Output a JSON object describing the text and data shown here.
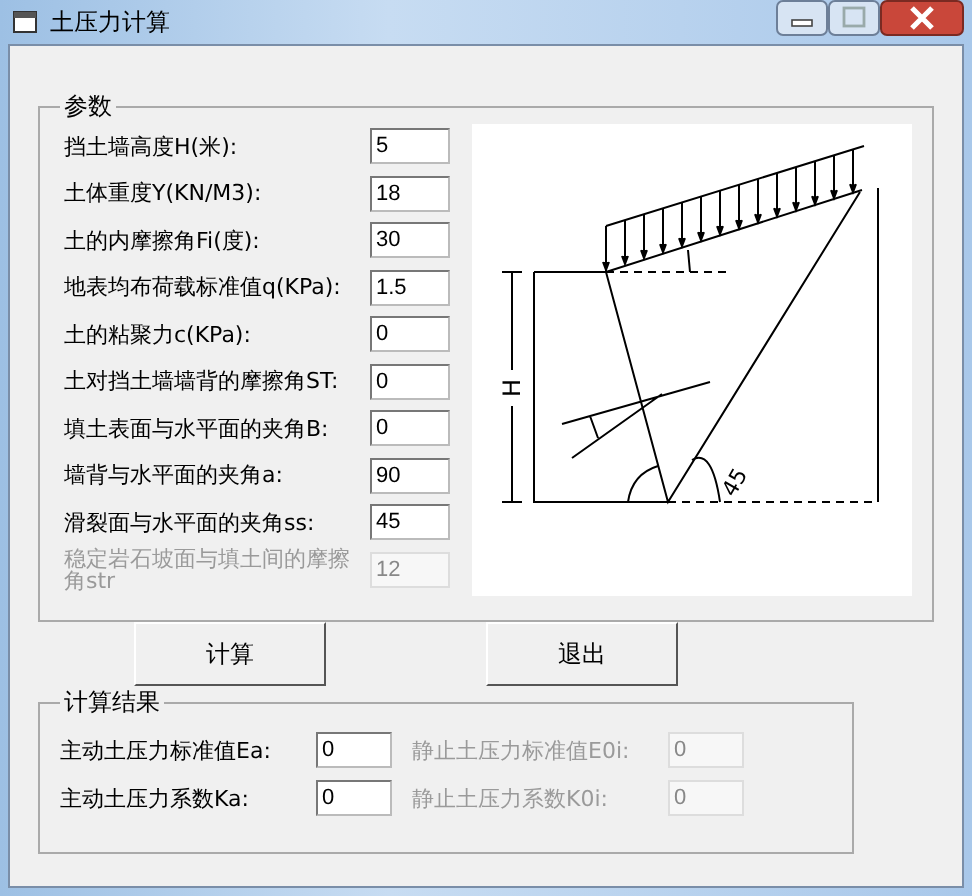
{
  "window": {
    "title": "土压力计算"
  },
  "parameters": {
    "title": "参数",
    "fields": [
      {
        "label": "挡土墙高度H(米):",
        "value": "5",
        "disabled": false
      },
      {
        "label": "土体重度Y(KN/M3):",
        "value": "18",
        "disabled": false
      },
      {
        "label": "土的内摩擦角Fi(度):",
        "value": "30",
        "disabled": false
      },
      {
        "label": "地表均布荷载标准值q(KPa):",
        "value": "1.5",
        "disabled": false
      },
      {
        "label": "土的粘聚力c(KPa):",
        "value": "0",
        "disabled": false
      },
      {
        "label": "土对挡土墙墙背的摩擦角ST:",
        "value": "0",
        "disabled": false
      },
      {
        "label": "填土表面与水平面的夹角B:",
        "value": "0",
        "disabled": false
      },
      {
        "label": "墙背与水平面的夹角a:",
        "value": "90",
        "disabled": false
      },
      {
        "label": "滑裂面与水平面的夹角ss:",
        "value": "45",
        "disabled": false
      },
      {
        "label": "稳定岩石坡面与填土间的摩擦角str",
        "value": "12",
        "disabled": true
      }
    ],
    "diagram": {
      "height_label": "H",
      "angle_label": "45"
    }
  },
  "buttons": [
    "计算",
    "退出"
  ],
  "results": {
    "title": "计算结果",
    "fields": [
      {
        "label": "主动土压力标准值Ea:",
        "value": "0",
        "disabled": false
      },
      {
        "label": "静止土压力标准值E0i:",
        "value": "0",
        "disabled": true
      },
      {
        "label": "主动土压力系数Ka:",
        "value": "0",
        "disabled": false
      },
      {
        "label": "静止土压力系数K0i:",
        "value": "0",
        "disabled": true
      }
    ]
  }
}
